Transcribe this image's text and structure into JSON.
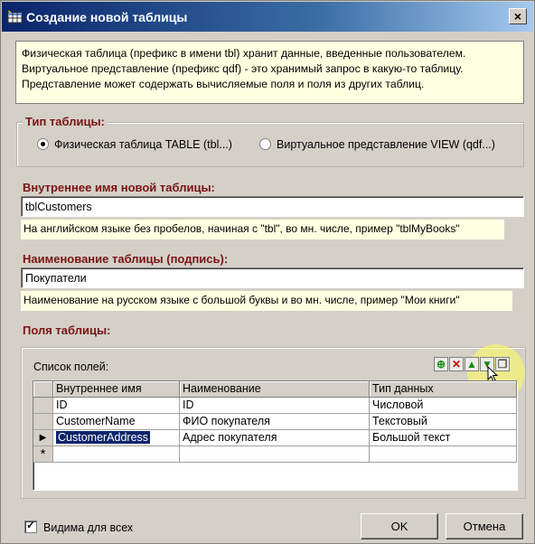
{
  "window": {
    "title": "Создание новой таблицы",
    "close_glyph": "×"
  },
  "info": {
    "lines": [
      "Физическая таблица (префикс в имени tbl) хранит данные, введенные пользователем.",
      "Виртуальное представление (префикс qdf) - это хранимый запрос в какую-то таблицу.",
      "Представление может содержать вычисляемые поля и поля из других таблиц."
    ]
  },
  "table_type": {
    "label": "Тип таблицы:",
    "options": [
      "Физическая таблица TABLE (tbl...)",
      "Виртуальное представление VIEW (qdf...)"
    ],
    "selected_index": 0
  },
  "internal_name": {
    "label": "Внутреннее имя новой таблицы:",
    "value": "tblCustomers",
    "hint": "На английском языке без пробелов, начиная с \"tbl\", во мн. числе, пример \"tblMyBooks\""
  },
  "caption": {
    "label": "Наименование таблицы (подпись):",
    "value": "Покупатели",
    "hint": "Наименование на русском языке с большой буквы и во мн. числе, пример \"Мои книги\""
  },
  "fields": {
    "label": "Поля таблицы:",
    "list_label": "Список полей:",
    "toolbar": [
      "add-icon",
      "delete-icon",
      "move-up-icon",
      "move-down-icon",
      "copy-icon"
    ],
    "columns": [
      "Внутреннее имя",
      "Наименование",
      "Тип данных"
    ],
    "rows": [
      [
        "ID",
        "ID",
        "Числовой"
      ],
      [
        "CustomerName",
        "ФИО покупателя",
        "Текстовый"
      ],
      [
        "CustomerAddress",
        "Адрес покупателя",
        "Большой текст"
      ]
    ],
    "new_row_marker": "*",
    "current_row_marker": "▶"
  },
  "visible_for_all": {
    "label": "Видима для всех",
    "checked": true
  },
  "buttons": {
    "ok": "OK",
    "cancel": "Отмена"
  }
}
